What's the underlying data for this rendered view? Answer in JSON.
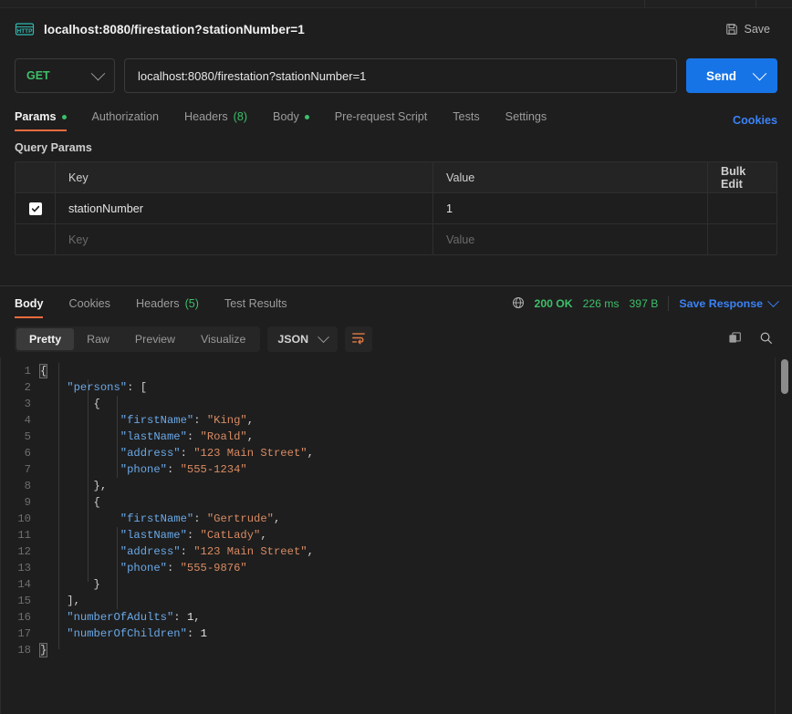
{
  "window": {
    "request_title": "localhost:8080/firestation?stationNumber=1",
    "protocol_badge": "HTTP",
    "save_label": "Save"
  },
  "url_bar": {
    "method": "GET",
    "url": "localhost:8080/firestation?stationNumber=1",
    "send_label": "Send"
  },
  "request_tabs": {
    "items": [
      {
        "label": "Params",
        "active": true,
        "dot": true
      },
      {
        "label": "Authorization",
        "active": false,
        "dot": false
      },
      {
        "label": "Headers",
        "active": false,
        "count": "(8)"
      },
      {
        "label": "Body",
        "active": false,
        "dot": true
      },
      {
        "label": "Pre-request Script",
        "active": false
      },
      {
        "label": "Tests",
        "active": false
      },
      {
        "label": "Settings",
        "active": false
      }
    ],
    "cookies_label": "Cookies"
  },
  "query_params": {
    "section_label": "Query Params",
    "headers": {
      "key": "Key",
      "value": "Value",
      "bulk_edit": "Bulk Edit"
    },
    "rows": [
      {
        "checked": true,
        "key": "stationNumber",
        "value": "1"
      }
    ],
    "placeholder_row": {
      "key": "Key",
      "value": "Value"
    }
  },
  "response": {
    "tabs": [
      {
        "label": "Body",
        "active": true
      },
      {
        "label": "Cookies",
        "active": false
      },
      {
        "label": "Headers",
        "active": false,
        "count": "(5)"
      },
      {
        "label": "Test Results",
        "active": false
      }
    ],
    "status": "200 OK",
    "time": "226 ms",
    "size": "397 B",
    "save_response_label": "Save Response"
  },
  "view_bar": {
    "modes": [
      {
        "label": "Pretty",
        "active": true
      },
      {
        "label": "Raw",
        "active": false
      },
      {
        "label": "Preview",
        "active": false
      },
      {
        "label": "Visualize",
        "active": false
      }
    ],
    "language": "JSON"
  },
  "body_code": {
    "language": "json",
    "lines": [
      {
        "n": "1",
        "segments": [
          {
            "t": "{",
            "c": "p brace-hl"
          }
        ]
      },
      {
        "n": "2",
        "segments": [
          {
            "t": "    ",
            "c": "p"
          },
          {
            "t": "\"persons\"",
            "c": "k"
          },
          {
            "t": ": [",
            "c": "p"
          }
        ]
      },
      {
        "n": "3",
        "segments": [
          {
            "t": "        {",
            "c": "p"
          }
        ]
      },
      {
        "n": "4",
        "segments": [
          {
            "t": "            ",
            "c": "p"
          },
          {
            "t": "\"firstName\"",
            "c": "k"
          },
          {
            "t": ": ",
            "c": "p"
          },
          {
            "t": "\"King\"",
            "c": "s"
          },
          {
            "t": ",",
            "c": "p"
          }
        ]
      },
      {
        "n": "5",
        "segments": [
          {
            "t": "            ",
            "c": "p"
          },
          {
            "t": "\"lastName\"",
            "c": "k"
          },
          {
            "t": ": ",
            "c": "p"
          },
          {
            "t": "\"Roald\"",
            "c": "s"
          },
          {
            "t": ",",
            "c": "p"
          }
        ]
      },
      {
        "n": "6",
        "segments": [
          {
            "t": "            ",
            "c": "p"
          },
          {
            "t": "\"address\"",
            "c": "k"
          },
          {
            "t": ": ",
            "c": "p"
          },
          {
            "t": "\"123 Main Street\"",
            "c": "s"
          },
          {
            "t": ",",
            "c": "p"
          }
        ]
      },
      {
        "n": "7",
        "segments": [
          {
            "t": "            ",
            "c": "p"
          },
          {
            "t": "\"phone\"",
            "c": "k"
          },
          {
            "t": ": ",
            "c": "p"
          },
          {
            "t": "\"555-1234\"",
            "c": "s"
          }
        ]
      },
      {
        "n": "8",
        "segments": [
          {
            "t": "        },",
            "c": "p"
          }
        ]
      },
      {
        "n": "9",
        "segments": [
          {
            "t": "        {",
            "c": "p"
          }
        ]
      },
      {
        "n": "10",
        "segments": [
          {
            "t": "            ",
            "c": "p"
          },
          {
            "t": "\"firstName\"",
            "c": "k"
          },
          {
            "t": ": ",
            "c": "p"
          },
          {
            "t": "\"Gertrude\"",
            "c": "s"
          },
          {
            "t": ",",
            "c": "p"
          }
        ]
      },
      {
        "n": "11",
        "segments": [
          {
            "t": "            ",
            "c": "p"
          },
          {
            "t": "\"lastName\"",
            "c": "k"
          },
          {
            "t": ": ",
            "c": "p"
          },
          {
            "t": "\"CatLady\"",
            "c": "s"
          },
          {
            "t": ",",
            "c": "p"
          }
        ]
      },
      {
        "n": "12",
        "segments": [
          {
            "t": "            ",
            "c": "p"
          },
          {
            "t": "\"address\"",
            "c": "k"
          },
          {
            "t": ": ",
            "c": "p"
          },
          {
            "t": "\"123 Main Street\"",
            "c": "s"
          },
          {
            "t": ",",
            "c": "p"
          }
        ]
      },
      {
        "n": "13",
        "segments": [
          {
            "t": "            ",
            "c": "p"
          },
          {
            "t": "\"phone\"",
            "c": "k"
          },
          {
            "t": ": ",
            "c": "p"
          },
          {
            "t": "\"555-9876\"",
            "c": "s"
          }
        ]
      },
      {
        "n": "14",
        "segments": [
          {
            "t": "        }",
            "c": "p"
          }
        ]
      },
      {
        "n": "15",
        "segments": [
          {
            "t": "    ],",
            "c": "p"
          }
        ]
      },
      {
        "n": "16",
        "segments": [
          {
            "t": "    ",
            "c": "p"
          },
          {
            "t": "\"numberOfAdults\"",
            "c": "k"
          },
          {
            "t": ": ",
            "c": "p"
          },
          {
            "t": "1",
            "c": "n"
          },
          {
            "t": ",",
            "c": "p"
          }
        ]
      },
      {
        "n": "17",
        "segments": [
          {
            "t": "    ",
            "c": "p"
          },
          {
            "t": "\"numberOfChildren\"",
            "c": "k"
          },
          {
            "t": ": ",
            "c": "p"
          },
          {
            "t": "1",
            "c": "n"
          }
        ]
      },
      {
        "n": "18",
        "segments": [
          {
            "t": "}",
            "c": "p brace-hl"
          }
        ]
      }
    ]
  },
  "colors": {
    "accent_blue": "#1774e6",
    "link_blue": "#3b82f6",
    "success_green": "#3dbf6a",
    "active_underline": "#ef6c3e",
    "background": "#1e1e1e"
  }
}
